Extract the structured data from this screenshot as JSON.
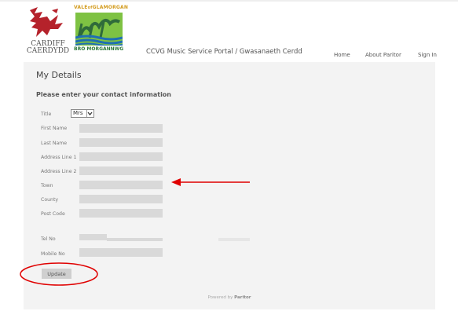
{
  "header": {
    "cardiff_logo": {
      "line1": "CARDIFF",
      "line2": "CAERDYDD"
    },
    "vale_logo": {
      "top_left": "VALE",
      "top_of": "of",
      "top_right": "GLAMORGAN",
      "bottom": "BRO MORGANNWG"
    },
    "portal_title": "CCVG Music Service Portal / Gwasanaeth Cerdd",
    "nav": {
      "home": "Home",
      "about": "About Paritor",
      "signin": "Sign In"
    }
  },
  "page": {
    "heading": "My Details",
    "subheading": "Please enter your contact information"
  },
  "form": {
    "title": {
      "label": "Title",
      "value": "Mrs"
    },
    "first_name": {
      "label": "First Name",
      "value": ""
    },
    "last_name": {
      "label": "Last Name",
      "value": ""
    },
    "address1": {
      "label": "Address Line 1",
      "value": ""
    },
    "address2": {
      "label": "Address Line 2",
      "value": ""
    },
    "town": {
      "label": "Town",
      "value": ""
    },
    "county": {
      "label": "County",
      "value": ""
    },
    "postcode": {
      "label": "Post Code",
      "value": ""
    },
    "tel": {
      "label": "Tel No",
      "value": ""
    },
    "mobile": {
      "label": "Mobile No",
      "value": ""
    },
    "update_label": "Update"
  },
  "footer": {
    "prefix": "Powered by",
    "brand": "Paritor"
  },
  "colors": {
    "annotation": "#e00000",
    "content_bg": "#f3f3f3",
    "input_bg": "#d9d9d9",
    "cardiff_red": "#b5222b",
    "vale_green": "#2f7a3b",
    "vale_gold": "#d39b1d"
  }
}
